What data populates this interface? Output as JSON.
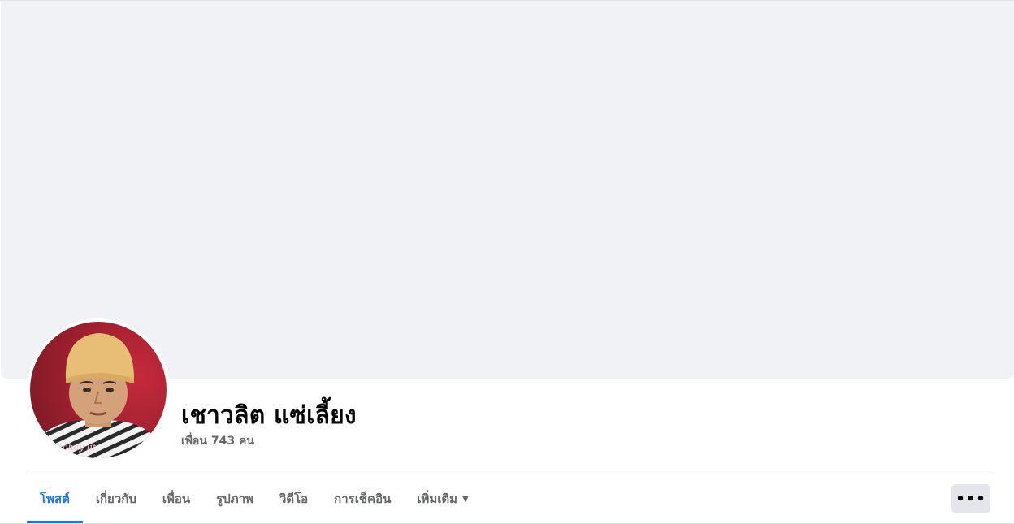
{
  "profile": {
    "name": "เชาวลิต แซ่เลี้ยง",
    "friends_text": "เพื่อน 743 คน",
    "photo_watermark": "ohay lit"
  },
  "tabs": [
    {
      "label": "โพสต์",
      "active": true
    },
    {
      "label": "เกี่ยวกับ",
      "active": false
    },
    {
      "label": "เพื่อน",
      "active": false
    },
    {
      "label": "รูปภาพ",
      "active": false
    },
    {
      "label": "วิดีโอ",
      "active": false
    },
    {
      "label": "การเช็คอิน",
      "active": false
    },
    {
      "label": "เพิ่มเติม",
      "active": false,
      "dropdown": true
    }
  ],
  "more_button": {
    "label": "•••",
    "icon": "ellipsis-icon"
  },
  "colors": {
    "accent": "#1877f2",
    "cover_bg": "#f0f2f5",
    "secondary_text": "#65676b",
    "button_bg": "#e4e6eb"
  }
}
